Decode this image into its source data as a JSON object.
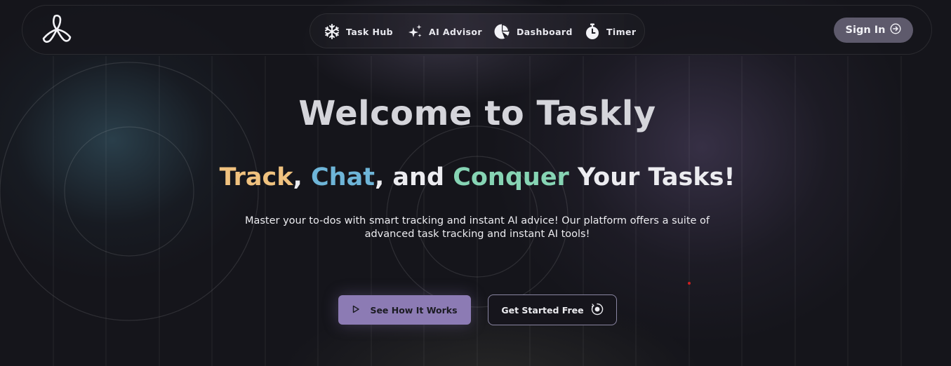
{
  "nav": {
    "items": [
      {
        "label": "Task Hub",
        "icon": "snowflake-icon"
      },
      {
        "label": "AI Advisor",
        "icon": "sparkles-icon"
      },
      {
        "label": "Dashboard",
        "icon": "pie-chart-icon"
      },
      {
        "label": "Timer",
        "icon": "stopwatch-icon"
      }
    ],
    "signin_label": "Sign In",
    "signin_icon": "arrow-right-circle-icon",
    "logo_icon": "propeller-logo-icon"
  },
  "hero": {
    "title": "Welcome to Taskly",
    "subtitle": {
      "word1": "Track",
      "sep1": ", ",
      "word2": "Chat",
      "sep2": ", and ",
      "word3": "Conquer",
      "rest": " Your Tasks!"
    },
    "description": "Master your to-dos with smart tracking and instant AI advice! Our platform offers a suite of advanced task tracking and instant AI tools!"
  },
  "buttons": {
    "how_label": "See How It Works",
    "how_icon": "play-icon",
    "start_label": "Get Started Free",
    "start_icon": "target-icon"
  },
  "colors": {
    "background": "#15151b",
    "track": "#f0c27f",
    "chat": "#6eb5d8",
    "conquer": "#86d4b4",
    "primary_button": "#8c7bb4",
    "signin_button": "#5e5a6c"
  }
}
